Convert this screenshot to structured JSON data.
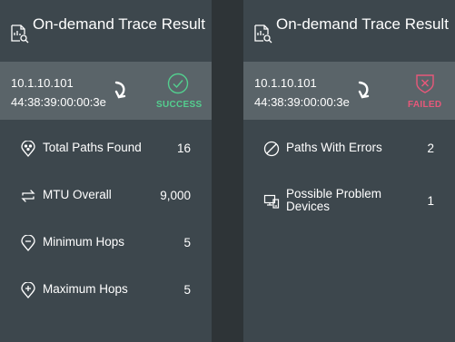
{
  "colors": {
    "background": "#3d474d",
    "highlight": "#5a6469",
    "success": "#53cf8f",
    "failed": "#e8587a",
    "gutter": "#2e3437"
  },
  "left_panel": {
    "title": "On-demand Trace Result",
    "title_icon": "trace-report-icon",
    "ip": "10.1.10.101",
    "mac": "44:38:39:00:00:3e",
    "status": "SUCCESS",
    "status_icon": "check-circle-icon",
    "stats": [
      {
        "label": "Total Paths Found",
        "value": "16",
        "icon": "paths-pin-icon"
      },
      {
        "label": "MTU Overall",
        "value": "9,000",
        "icon": "swap-arrows-icon"
      },
      {
        "label": "Minimum Hops",
        "value": "5",
        "icon": "pin-minus-icon"
      },
      {
        "label": "Maximum Hops",
        "value": "5",
        "icon": "pin-plus-icon"
      }
    ]
  },
  "right_panel": {
    "title": "On-demand Trace Result",
    "title_icon": "trace-report-icon",
    "ip": "10.1.10.101",
    "mac": "44:38:39:00:00:3e",
    "status": "FAILED",
    "status_icon": "shield-x-icon",
    "stats": [
      {
        "label": "Paths With Errors",
        "value": "2",
        "icon": "slash-circle-icon"
      },
      {
        "label": "Possible Problem Devices",
        "value": "1",
        "icon": "devices-icon"
      }
    ]
  }
}
